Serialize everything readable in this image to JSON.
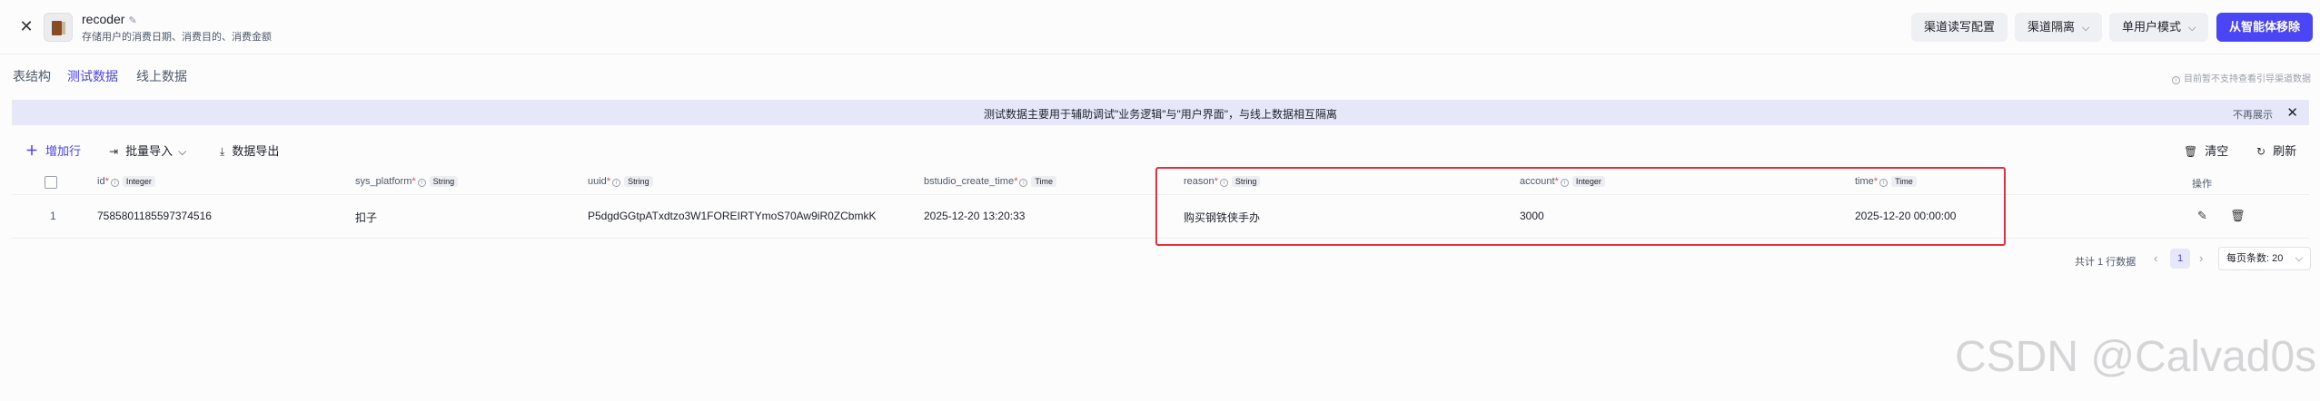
{
  "header": {
    "close_icon": "close-icon",
    "app_name": "recoder",
    "app_desc": "存储用户的消费日期、消费目的、消费金额",
    "buttons": {
      "channel_rw": "渠道读写配置",
      "channel_iso": "渠道隔离",
      "user_mode": "单用户模式",
      "remove": "从智能体移除"
    }
  },
  "tabs": [
    "表结构",
    "测试数据",
    "线上数据"
  ],
  "active_tab": "测试数据",
  "right_note": "目前暂不支持查看引导渠道数据",
  "banner": {
    "text": "测试数据主要用于辅助调试\"业务逻辑\"与\"用户界面\"，与线上数据相互隔离",
    "hide": "不再展示"
  },
  "toolbar": {
    "add_row": "增加行",
    "bulk_import": "批量导入",
    "export": "数据导出",
    "clear": "清空",
    "refresh": "刷新"
  },
  "columns": [
    {
      "name": "id",
      "type": "Integer"
    },
    {
      "name": "sys_platform",
      "type": "String"
    },
    {
      "name": "uuid",
      "type": "String"
    },
    {
      "name": "bstudio_create_time",
      "type": "Time"
    },
    {
      "name": "reason",
      "type": "String"
    },
    {
      "name": "account",
      "type": "Integer"
    },
    {
      "name": "time",
      "type": "Time"
    }
  ],
  "ops_header": "操作",
  "rows": [
    {
      "num": "1",
      "id": "7585801185597374516",
      "sys_platform": "扣子",
      "uuid": "P5dgdGGtpATxdtzo3W1FOREIRTYmoS70Aw9iR0ZCbmkK",
      "bstudio_create_time": "2025-12-20 13:20:33",
      "reason": "购买钢铁侠手办",
      "account": "3000",
      "time": "2025-12-20 00:00:00"
    }
  ],
  "pagination": {
    "total": "共计 1 行数据",
    "current": "1",
    "page_size": "每页条数: 20"
  },
  "watermark": "CSDN @Calvad0s",
  "colors": {
    "accent": "#4a45f5",
    "highlight": "#e53040",
    "banner": "#e6e8fa"
  }
}
